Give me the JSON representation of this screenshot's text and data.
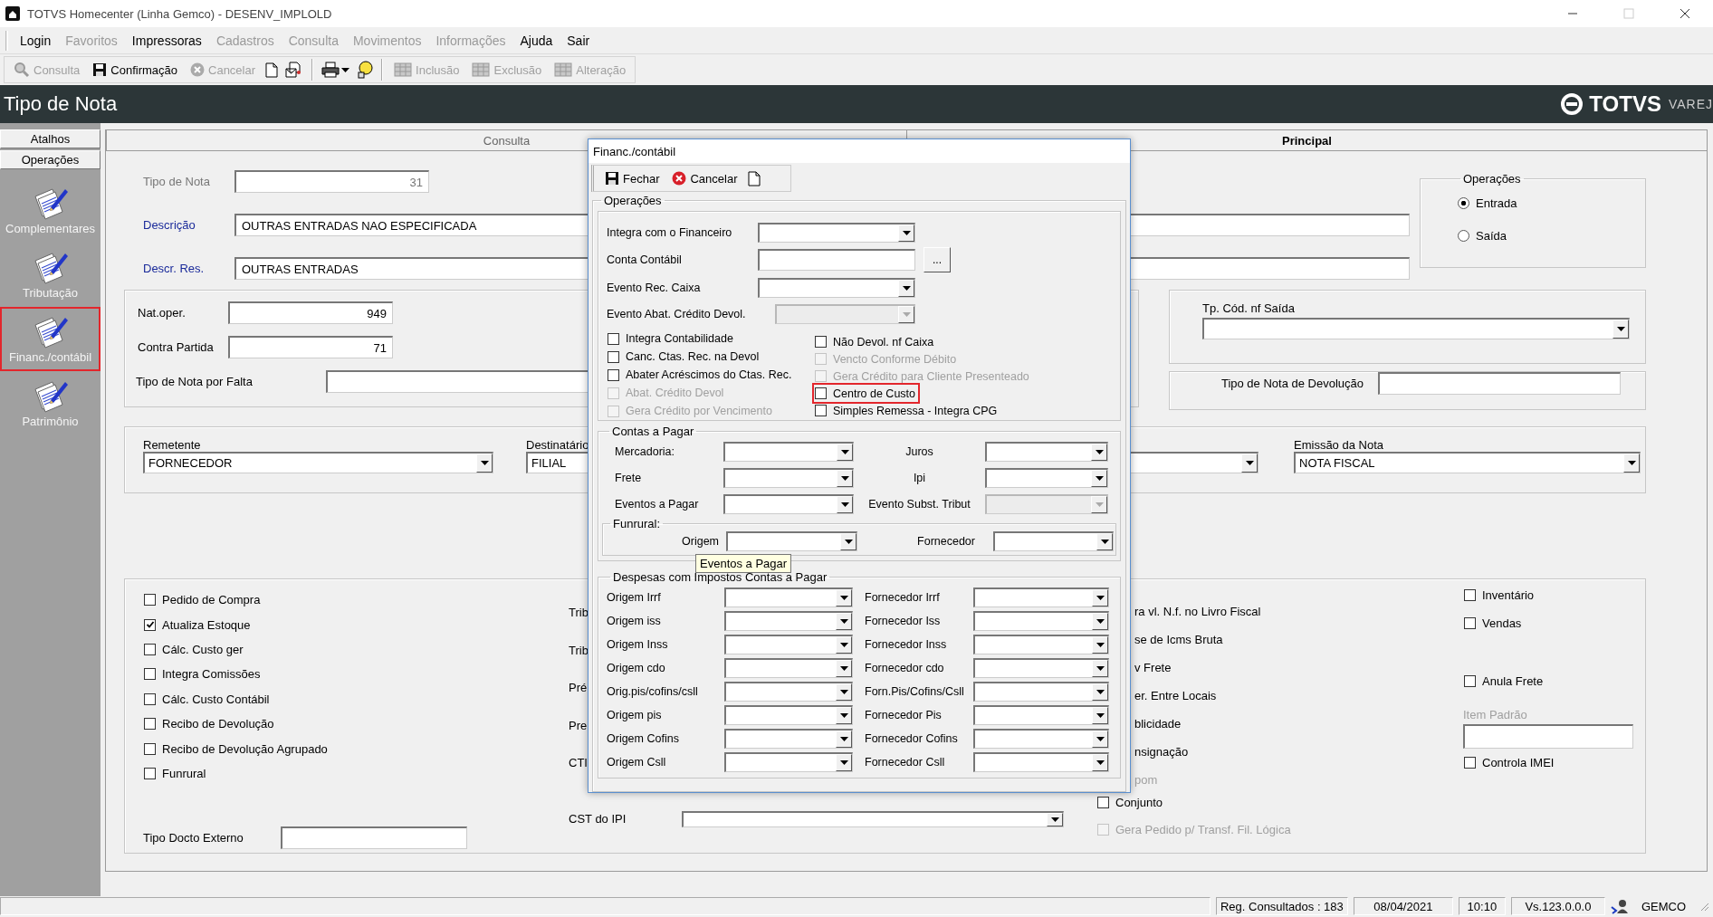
{
  "window": {
    "title": "TOTVS Homecenter (Linha Gemco) - DESENV_IMPLOLD"
  },
  "menu": [
    {
      "label": "Login",
      "disabled": false
    },
    {
      "label": "Favoritos",
      "disabled": true
    },
    {
      "label": "Impressoras",
      "disabled": false
    },
    {
      "label": "Cadastros",
      "disabled": true
    },
    {
      "label": "Consulta",
      "disabled": true
    },
    {
      "label": "Movimentos",
      "disabled": true
    },
    {
      "label": "Informações",
      "disabled": true
    },
    {
      "label": "Ajuda",
      "disabled": false
    },
    {
      "label": "Sair",
      "disabled": false
    }
  ],
  "toolbar": [
    {
      "label": "Consulta",
      "disabled": true
    },
    {
      "label": "Confirmação",
      "disabled": false
    },
    {
      "label": "Cancelar",
      "disabled": true
    },
    {
      "label": "Inclusão",
      "disabled": true
    },
    {
      "label": "Exclusão",
      "disabled": true
    },
    {
      "label": "Alteração",
      "disabled": true
    }
  ],
  "header": {
    "title": "Tipo de Nota",
    "logo": "TOTVS",
    "logo_suffix": "VAREJ"
  },
  "sidebar": {
    "tabs": [
      "Atalhos",
      "Operações"
    ],
    "items": [
      {
        "label": "Complementares",
        "selected": false
      },
      {
        "label": "Tributação",
        "selected": false
      },
      {
        "label": "Financ./contábil",
        "selected": true
      },
      {
        "label": "Patrimônio",
        "selected": false
      }
    ]
  },
  "tabs": [
    {
      "label": "Consulta",
      "selected": false
    },
    {
      "label": "Principal",
      "selected": true
    }
  ],
  "form": {
    "tipo_de_nota": {
      "label": "Tipo de Nota",
      "value": "31",
      "disabled": true
    },
    "descricao": {
      "label": "Descrição",
      "value": "OUTRAS ENTRADAS NAO ESPECIFICADA"
    },
    "descr_res": {
      "label": "Descr. Res.",
      "value": "OUTRAS ENTRADAS"
    },
    "operacoes": {
      "title": "Operações",
      "options": [
        {
          "label": "Entrada",
          "selected": true
        },
        {
          "label": "Saída",
          "selected": false
        }
      ]
    },
    "nat_oper": {
      "label": "Nat.oper.",
      "value": "949"
    },
    "contra_partida": {
      "label": "Contra Partida",
      "value": "71"
    },
    "tipo_nota_falta": {
      "label": "Tipo de Nota por Falta"
    },
    "tp_cod_nf_saida": {
      "label": "Tp. Cód. nf Saída"
    },
    "tipo_nota_devolucao": {
      "label": "Tipo de Nota de Devolução"
    },
    "remetente": {
      "label": "Remetente",
      "value": "FORNECEDOR"
    },
    "destinatario": {
      "label": "Destinatário",
      "value": "FILIAL"
    },
    "emissao": {
      "label": "Emissão da Nota",
      "value": "NOTA FISCAL"
    },
    "flags": [
      {
        "label": "Pedido de Compra",
        "checked": false
      },
      {
        "label": "Atualiza Estoque",
        "checked": true
      },
      {
        "label": "Cálc. Custo ger",
        "checked": false
      },
      {
        "label": "Integra Comissões",
        "checked": false
      },
      {
        "label": "Cálc. Custo Contábil",
        "checked": false
      },
      {
        "label": "Recibo de Devolução",
        "checked": false
      },
      {
        "label": "Recibo de Devolução Agrupado",
        "checked": false
      },
      {
        "label": "Funrural",
        "checked": false
      }
    ],
    "tipo_docto_externo": {
      "label": "Tipo Docto Externo"
    },
    "covered_left": [
      "Trib",
      "Trib",
      "Pré",
      "Pre",
      "CTI"
    ],
    "cst_ipi": {
      "label": "CST do IPI"
    },
    "covered_right": [
      {
        "kind": "text",
        "label": "ra vl. N.f. no Livro Fiscal",
        "disabled": false
      },
      {
        "kind": "text",
        "label": "se de Icms Bruta",
        "disabled": false
      },
      {
        "kind": "text",
        "label": "v Frete",
        "disabled": false
      },
      {
        "kind": "text",
        "label": "er. Entre Locais",
        "disabled": false
      },
      {
        "kind": "text",
        "label": "blicidade",
        "disabled": false
      },
      {
        "kind": "text",
        "label": "nsignação",
        "disabled": false
      },
      {
        "kind": "text",
        "label": "pom",
        "disabled": true
      },
      {
        "kind": "checkbox",
        "label": "Conjunto",
        "checked": false,
        "disabled": false
      },
      {
        "kind": "checkbox",
        "label": "Gera Pedido p/ Transf. Fil. Lógica",
        "checked": false,
        "disabled": true
      }
    ],
    "right_column": [
      {
        "kind": "checkbox",
        "label": "Inventário",
        "checked": false
      },
      {
        "kind": "checkbox",
        "label": "Vendas",
        "checked": false
      },
      {
        "kind": "checkbox",
        "label": "Anula Frete",
        "checked": false
      },
      {
        "kind": "field",
        "label": "Item Padrão",
        "disabled": true
      },
      {
        "kind": "checkbox",
        "label": "Controla IMEI",
        "checked": false
      }
    ]
  },
  "dialog": {
    "title": "Financ./contábil",
    "toolbar": [
      "Fechar",
      "Cancelar"
    ],
    "group_title": "Operações",
    "fields": [
      {
        "kind": "select",
        "label": "Integra com o Financeiro",
        "disabled": false
      },
      {
        "kind": "lookup",
        "label": "Conta Contábil",
        "button": "..."
      },
      {
        "kind": "select",
        "label": "Evento Rec. Caixa",
        "disabled": false
      },
      {
        "kind": "select",
        "label": "Evento Abat. Crédito Devol.",
        "disabled": true
      }
    ],
    "checks_left": [
      {
        "label": "Integra Contabilidade",
        "checked": false,
        "disabled": false
      },
      {
        "label": "Canc. Ctas. Rec. na Devol",
        "checked": false,
        "disabled": false
      },
      {
        "label": "Abater Acréscimos do Ctas. Rec.",
        "checked": false,
        "disabled": false
      },
      {
        "label": "Abat. Crédito Devol",
        "checked": false,
        "disabled": true
      },
      {
        "label": "Gera Crédito por Vencimento",
        "checked": false,
        "disabled": true
      }
    ],
    "checks_right": [
      {
        "label": "Não Devol. nf Caixa",
        "checked": false,
        "disabled": false,
        "highlighted": false
      },
      {
        "label": "Vencto Conforme Débito",
        "checked": false,
        "disabled": true,
        "highlighted": false
      },
      {
        "label": "Gera Crédito para Cliente Presenteado",
        "checked": false,
        "disabled": true,
        "highlighted": false
      },
      {
        "label": "Centro de Custo",
        "checked": false,
        "disabled": false,
        "highlighted": true
      },
      {
        "label": "Simples Remessa - Integra CPG",
        "checked": false,
        "disabled": false,
        "highlighted": false
      }
    ],
    "contas_a_pagar": {
      "title": "Contas a Pagar",
      "rows": [
        {
          "left": {
            "label": "Mercadoria:",
            "disabled": false
          },
          "right": {
            "label": "Juros",
            "disabled": false
          }
        },
        {
          "left": {
            "label": "Frete",
            "disabled": false
          },
          "right": {
            "label": "Ipi",
            "disabled": false
          }
        },
        {
          "left": {
            "label": "Eventos a Pagar",
            "disabled": false
          },
          "right": {
            "label": "Evento Subst. Tribut",
            "disabled": true
          }
        }
      ],
      "funrural": {
        "title": "Funrural:",
        "left": "Origem",
        "right": "Fornecedor"
      }
    },
    "tooltip": "Eventos a Pagar",
    "despesas": {
      "title": "Despesas com Impostos Contas a Pagar",
      "rows": [
        {
          "left": "Origem Irrf",
          "right": "Fornecedor Irrf"
        },
        {
          "left": "Origem iss",
          "right": "Fornecedor Iss"
        },
        {
          "left": "Origem Inss",
          "right": "Fornecedor Inss"
        },
        {
          "left": "Origem cdo",
          "right": "Fornecedor cdo"
        },
        {
          "left": "Orig.pis/cofins/csll",
          "right": "Forn.Pis/Cofins/Csll"
        },
        {
          "left": "Origem pis",
          "right": "Fornecedor Pis"
        },
        {
          "left": "Origem Cofins",
          "right": "Fornecedor Cofins"
        },
        {
          "left": "Origem Csll",
          "right": "Fornecedor Csll"
        }
      ]
    }
  },
  "status_bar": {
    "record_count": "Reg. Consultados : 183",
    "date": "08/04/2021",
    "time": "10:10",
    "version": "Vs.123.0.0.0",
    "company": "GEMCO"
  }
}
